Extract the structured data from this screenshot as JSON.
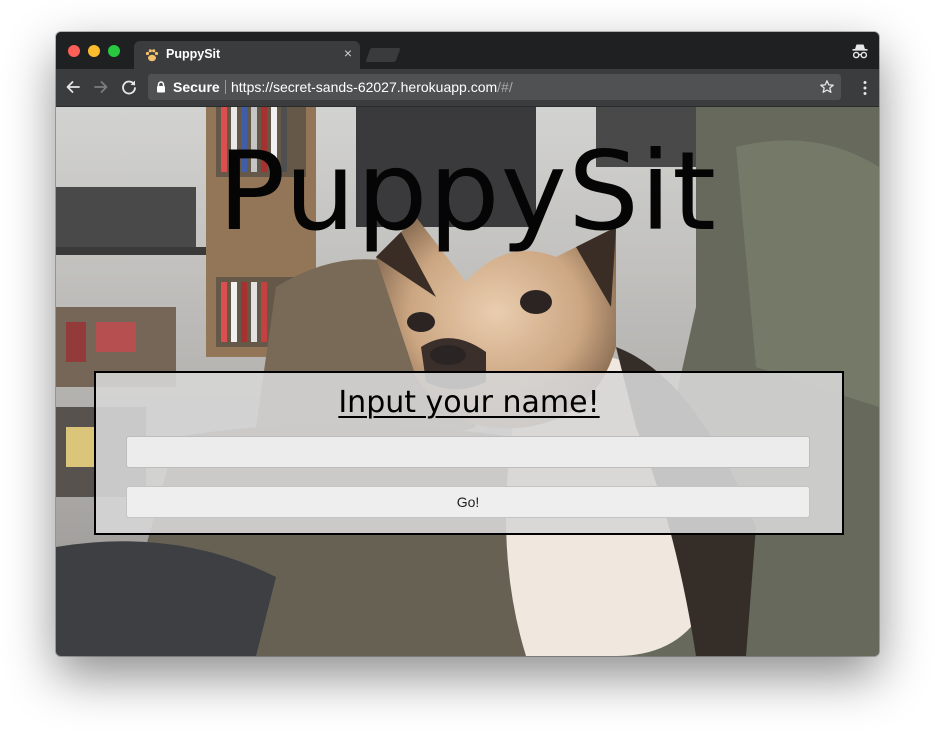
{
  "browser": {
    "tab": {
      "title": "PuppySit",
      "favicon": "paw-icon",
      "close": "×"
    },
    "address_bar": {
      "secure_label": "Secure",
      "url_host": "https://secret-sands-62027.herokuapp.com",
      "url_path": "/#/"
    },
    "icons": [
      "back-icon",
      "forward-icon",
      "reload-icon",
      "lock-icon",
      "star-icon",
      "menu-icon",
      "incognito-icon"
    ]
  },
  "page": {
    "brand_title": "PuppySit",
    "prompt": "Input your name!",
    "name_input": {
      "value": "",
      "placeholder": ""
    },
    "submit_label": "Go!"
  },
  "colors": {
    "titlebar": "#1f2022",
    "toolbar": "#3b3c3e",
    "omnibox": "#505153",
    "panel": "#d6d6d6",
    "panel_border": "#000000",
    "traffic_red": "#fc5f57",
    "traffic_yellow": "#fdbc2e",
    "traffic_green": "#28c840"
  }
}
